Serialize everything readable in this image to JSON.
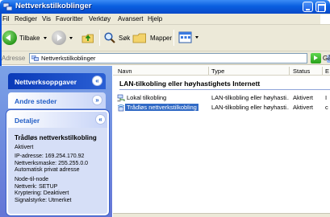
{
  "window": {
    "title": "Nettverkstilkoblinger"
  },
  "menu": {
    "items": [
      "Fil",
      "Rediger",
      "Vis",
      "Favoritter",
      "Verktøy",
      "Avansert",
      "Hjelp"
    ]
  },
  "toolbar": {
    "back_label": "Tilbake",
    "search_label": "Søk",
    "folders_label": "Mapper"
  },
  "address": {
    "label": "Adresse",
    "value": "Nettverkstilkoblinger",
    "go_label": "Gå"
  },
  "taskpane": {
    "tasks_header": "Nettverksoppgaver",
    "other_places_header": "Andre steder",
    "details_header": "Detaljer",
    "details": {
      "name": "Trådløs nettverkstilkobling",
      "status": "Aktivert",
      "ip": "IP-adresse: 169.254.170.92",
      "mask": "Nettverksmaske: 255.255.0.0",
      "auto": "Automatisk privat adresse",
      "mode": "Node-til-node",
      "network": "Nettverk: SETUP",
      "encryption": "Kryptering: Deaktivert",
      "signal": "Signalstyrke: Utmerket"
    }
  },
  "list": {
    "columns": {
      "name": "Navn",
      "type": "Type",
      "status": "Status",
      "extra": "E"
    },
    "group_title": "LAN-tilkobling eller høyhastighets Internett",
    "rows": [
      {
        "name": "Lokal tilkobling",
        "type": "LAN-tilkobling eller høyhasti...",
        "status": "Aktivert",
        "extra": "I"
      },
      {
        "name": "Trådløs nettverkstilkobling",
        "type": "LAN-tilkobling eller høyhasti...",
        "status": "Aktivert",
        "extra": "c"
      }
    ]
  },
  "colors": {
    "titlebar": "#0a5fe0",
    "taskpane": "#7ba2e7",
    "selection": "#316ac5"
  }
}
